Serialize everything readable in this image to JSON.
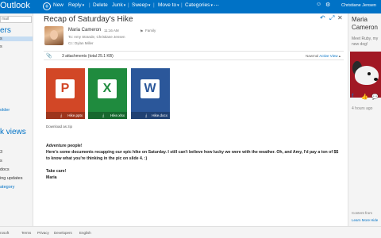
{
  "app": {
    "brand": "Outlook",
    "user_name": "Christiane Jensen"
  },
  "toolbar": {
    "new_label": "New",
    "reply_label": "Reply",
    "delete_label": "Delete",
    "junk_label": "Junk",
    "sweep_label": "Sweep",
    "move_label": "Move to",
    "categories_label": "Categories"
  },
  "leftnav": {
    "search_placeholder": "mail",
    "heading_folders": "ers",
    "folder_items": [
      "s",
      "s"
    ],
    "new_folder_label": "older",
    "heading_views": "k views",
    "view_items": [
      "3",
      "s",
      "docs",
      "ing updates"
    ],
    "new_category_label": "ategory"
  },
  "message": {
    "subject": "Recap of Saturday's Hike",
    "sender": "Maria Cameron",
    "time": "11:16 AM",
    "family_label": "Family",
    "to": "To: Amy Strande, Christiane Jensen",
    "cc": "Cc: Dylan Miller",
    "attachments_summary": "3 attachments (total 25.1 KB)",
    "view_prefix": "Nawmal",
    "view_active": "Active View",
    "attachments": [
      {
        "name": "Hike.pptx",
        "glyph": "P",
        "color": "#d24726"
      },
      {
        "name": "Hike.xlsx",
        "glyph": "X",
        "color": "#1f8b3e"
      },
      {
        "name": "Hike.docx",
        "glyph": "W",
        "color": "#2b579a"
      }
    ],
    "download_zip": "Download as zip",
    "body": [
      "Adventure people!",
      "Here's some documents recapping our epic hike on Saturday. I still can't believe how lucky we were with the weather. Oh, and Amy, I'd pay a ton of $$ to know what you're thinking in the pic on slide 4. :)",
      "",
      "Take care!",
      "Maria"
    ]
  },
  "people_pane": {
    "name_line1": "Maria",
    "name_line2": "Cameron",
    "note": "Meet Ruby, my new dog!",
    "time_ago": "4 hours ago",
    "content_from": "Content from",
    "learn_more": "Learn More",
    "hide": "Hide"
  },
  "footer": {
    "links": [
      "rosoft",
      "Terms",
      "Privacy",
      "Developers",
      "English"
    ]
  },
  "colors": {
    "accent": "#0072c6",
    "nav_bg": "#f4f4f4",
    "selected": "#c5dcf2"
  }
}
